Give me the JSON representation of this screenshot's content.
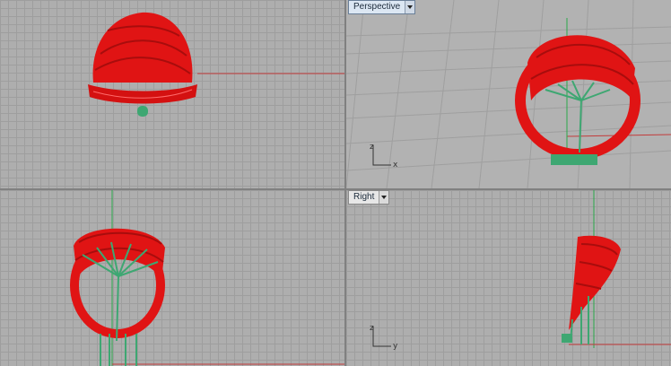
{
  "viewports": {
    "perspective": {
      "label": "Perspective"
    },
    "right": {
      "label": "Right"
    }
  },
  "axis_labels": {
    "perspective": {
      "vertical": "z",
      "horizontal": "x"
    },
    "right": {
      "vertical": "z",
      "horizontal": "y"
    }
  },
  "colors": {
    "model": "#e01414",
    "support": "#3ea772",
    "x_axis": "#c23b3b",
    "y_axis": "#2aa84a",
    "active_border": "#6a7f98"
  },
  "icons": {
    "viewport_menu": "chevron-down-icon"
  }
}
